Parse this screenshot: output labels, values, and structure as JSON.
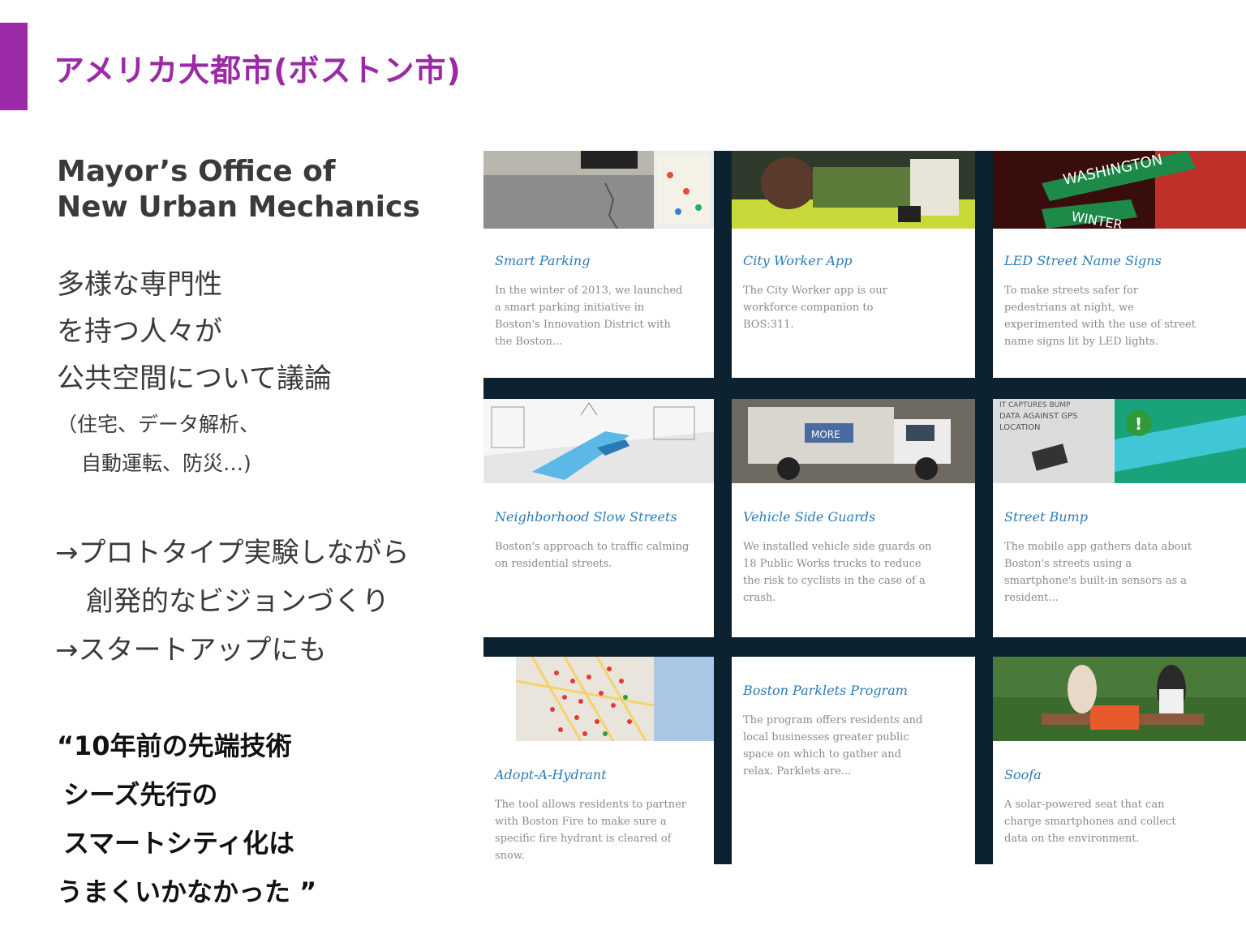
{
  "slide": {
    "title": "アメリカ大都市(ボストン市)",
    "accent_color": "#9b2aa6"
  },
  "org": {
    "line1": "Mayor’s Office of",
    "line2": "New Urban Mechanics"
  },
  "description": {
    "lines": [
      "多様な専門性",
      "を持つ人々が",
      "公共空間について議論"
    ],
    "sub_lines": [
      "（住宅、データ解析、",
      "自動運転、防災…)"
    ]
  },
  "bullets": {
    "line1": "→プロトタイプ実験しながら",
    "line2": "創発的なビジョンづくり",
    "line3": "→スタートアップにも"
  },
  "quote": {
    "line1": "“10年前の先端技術",
    "line2": "シーズ先行の",
    "line3": "スマートシティ化は",
    "line4": "うまくいかなかった ”"
  },
  "cards": [
    {
      "title": "Smart Parking",
      "text": "In the winter of 2013, we launched a smart parking initiative in Boston's Innovation District with the Boston..."
    },
    {
      "title": "City Worker App",
      "text": "The City Worker app is our workforce companion to BOS:311."
    },
    {
      "title": "LED Street Name Signs",
      "text": "To make streets safer for pedestrians at night, we experimented with the use of street name signs lit by LED lights."
    },
    {
      "title": "Neighborhood Slow Streets",
      "text": "Boston's approach to traffic calming on residential streets."
    },
    {
      "title": "Vehicle Side Guards",
      "text": "We installed vehicle side guards on 18 Public Works trucks to reduce the risk to cyclists in the case of a crash."
    },
    {
      "title": "Street Bump",
      "text": "The mobile app gathers data about Boston's streets using a smartphone's built-in sensors as a resident..."
    },
    {
      "title": "Adopt-A-Hydrant",
      "text": "The tool allows residents to partner with Boston Fire to make sure a specific fire hydrant is cleared of snow."
    },
    {
      "title": "Boston Parklets Program",
      "text": "The program offers residents and local businesses greater public space on which to gather and relax. Parklets are..."
    },
    {
      "title": "Soofa",
      "text": "A solar-powered seat that can charge smartphones and collect data on the environment."
    }
  ],
  "image_text": {
    "sign_1": "WASHINGTON",
    "sign_2": "WINTER",
    "bump_caption_1": "IT CAPTURES BUMP",
    "bump_caption_2": "DATA AGAINST GPS",
    "bump_caption_3": "LOCATION",
    "truck_label": "MORE"
  }
}
